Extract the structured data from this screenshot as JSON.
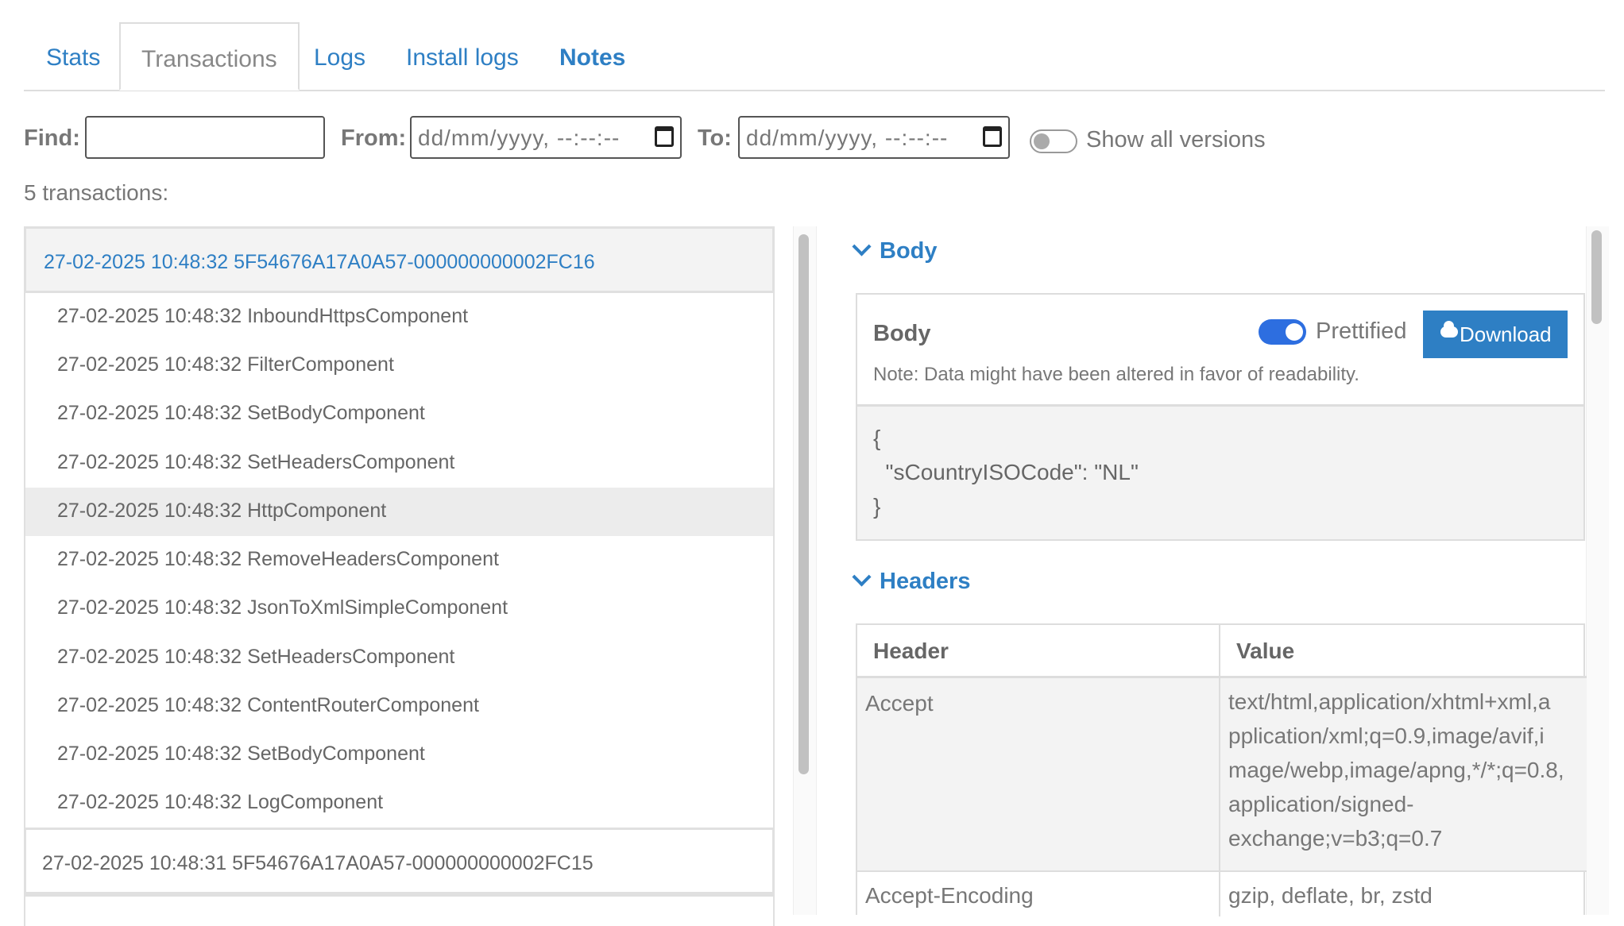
{
  "tabs": [
    {
      "label": "Stats"
    },
    {
      "label": "Transactions"
    },
    {
      "label": "Logs"
    },
    {
      "label": "Install logs"
    },
    {
      "label": "Notes"
    }
  ],
  "filters": {
    "find_label": "Find:",
    "find_value": "",
    "from_label": "From:",
    "from_placeholder": "dd/mm/yyyy, --:--:--",
    "to_label": "To:",
    "to_placeholder": "dd/mm/yyyy, --:--:--",
    "show_all_versions": "Show all versions"
  },
  "count_text": "5 transactions:",
  "transactions": {
    "selected": "27-02-2025 10:48:32 5F54676A17A0A57-000000000002FC16",
    "steps": [
      "27-02-2025 10:48:32 InboundHttpsComponent",
      "27-02-2025 10:48:32 FilterComponent",
      "27-02-2025 10:48:32 SetBodyComponent",
      "27-02-2025 10:48:32 SetHeadersComponent",
      "27-02-2025 10:48:32 HttpComponent",
      "27-02-2025 10:48:32 RemoveHeadersComponent",
      "27-02-2025 10:48:32 JsonToXmlSimpleComponent",
      "27-02-2025 10:48:32 SetHeadersComponent",
      "27-02-2025 10:48:32 ContentRouterComponent",
      "27-02-2025 10:48:32 SetBodyComponent",
      "27-02-2025 10:48:32 LogComponent"
    ],
    "next": "27-02-2025 10:48:31 5F54676A17A0A57-000000000002FC15"
  },
  "body_section": {
    "heading": "Body",
    "title": "Body",
    "prettified_label": "Prettified",
    "download_label": "Download",
    "note": "Note: Data might have been altered in favor of readability.",
    "content": "{\n  \"sCountryISOCode\": \"NL\"\n}"
  },
  "headers_section": {
    "heading": "Headers",
    "col_header": "Header",
    "col_value": "Value",
    "rows": [
      {
        "key": "Accept",
        "value": [
          "text/html,application/xhtml+xml,a",
          "pplication/xml;q=0.9,image/avif,i",
          "mage/webp,image/apng,*/*;q=0.8,",
          "application/signed-",
          "exchange;v=b3;q=0.7"
        ]
      },
      {
        "key": "Accept-Encoding",
        "value": [
          "gzip, deflate, br, zstd"
        ]
      }
    ]
  },
  "colors": {
    "accent": "#2e7fc4",
    "toggle_on": "#2d6ee0"
  }
}
